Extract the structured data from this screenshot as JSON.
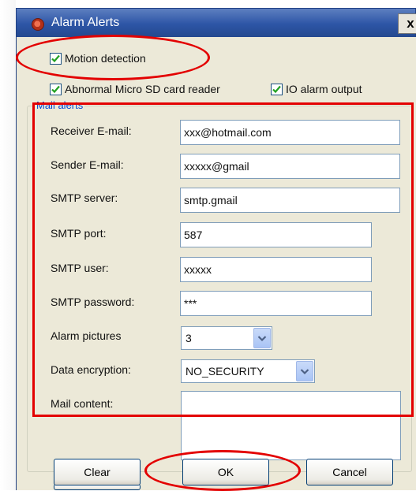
{
  "window": {
    "title": "Alarm Alerts",
    "close_glyph": "x",
    "icon": "app-icon"
  },
  "options": {
    "motion_detection": {
      "label": "Motion detection",
      "checked": true
    },
    "sd_card_reader": {
      "label": "Abnormal Micro SD card reader",
      "checked": true
    },
    "io_alarm_output": {
      "label": "IO alarm output",
      "checked": true
    }
  },
  "mail_alerts": {
    "legend": "Mail alerts",
    "receiver_email": {
      "label": "Receiver E-mail:",
      "value": "xxx@hotmail.com"
    },
    "sender_email": {
      "label": "Sender E-mail:",
      "value": "xxxxx@gmail"
    },
    "smtp_server": {
      "label": "SMTP server:",
      "value": "smtp.gmail"
    },
    "smtp_port": {
      "label": "SMTP port:",
      "value": "587"
    },
    "smtp_user": {
      "label": "SMTP user:",
      "value": "xxxxx"
    },
    "smtp_password": {
      "label": "SMTP password:",
      "value": "***"
    },
    "alarm_pictures": {
      "label": "Alarm pictures",
      "value": "3"
    },
    "data_encryption": {
      "label": "Data encryption:",
      "value": "NO_SECURITY"
    },
    "mail_content": {
      "label": "Mail content:",
      "value": ""
    }
  },
  "buttons": {
    "clear": "Clear",
    "ok": "OK",
    "cancel": "Cancel"
  },
  "colors": {
    "titlebar": "#2d55a6",
    "dialog_bg": "#ece9d8",
    "legend_text": "#0046d5",
    "annotation_red": "#e30000"
  }
}
